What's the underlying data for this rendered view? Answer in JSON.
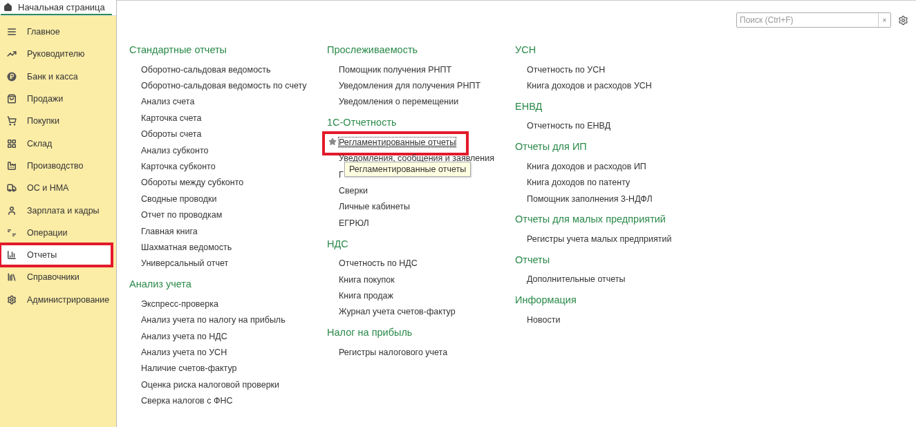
{
  "home_tab": {
    "label": "Начальная страница",
    "selected": true
  },
  "sidebar": {
    "items": [
      {
        "label": "Главное",
        "selected": false,
        "highlighted": false
      },
      {
        "label": "Руководителю",
        "selected": false,
        "highlighted": false
      },
      {
        "label": "Банк и касса",
        "selected": false,
        "highlighted": false
      },
      {
        "label": "Продажи",
        "selected": false,
        "highlighted": false
      },
      {
        "label": "Покупки",
        "selected": false,
        "highlighted": false
      },
      {
        "label": "Склад",
        "selected": false,
        "highlighted": false
      },
      {
        "label": "Производство",
        "selected": false,
        "highlighted": false
      },
      {
        "label": "ОС и НМА",
        "selected": false,
        "highlighted": false
      },
      {
        "label": "Зарплата и кадры",
        "selected": false,
        "highlighted": false
      },
      {
        "label": "Операции",
        "selected": false,
        "highlighted": false
      },
      {
        "label": "Отчеты",
        "selected": true,
        "highlighted": true
      },
      {
        "label": "Справочники",
        "selected": false,
        "highlighted": false
      },
      {
        "label": "Администрирование",
        "selected": false,
        "highlighted": false
      }
    ]
  },
  "search": {
    "placeholder": "Поиск (Ctrl+F)",
    "clear": "×"
  },
  "columns": [
    {
      "sections": [
        {
          "title": "Стандартные отчеты",
          "items": [
            {
              "label": "Оборотно-сальдовая ведомость",
              "highlighted": false
            },
            {
              "label": "Оборотно-сальдовая ведомость по счету",
              "highlighted": false
            },
            {
              "label": "Анализ счета",
              "highlighted": false
            },
            {
              "label": "Карточка счета",
              "highlighted": false
            },
            {
              "label": "Обороты счета",
              "highlighted": false
            },
            {
              "label": "Анализ субконто",
              "highlighted": false
            },
            {
              "label": "Карточка субконто",
              "highlighted": false
            },
            {
              "label": "Обороты между субконто",
              "highlighted": false
            },
            {
              "label": "Сводные проводки",
              "highlighted": false
            },
            {
              "label": "Отчет по проводкам",
              "highlighted": false
            },
            {
              "label": "Главная книга",
              "highlighted": false
            },
            {
              "label": "Шахматная ведомость",
              "highlighted": false
            },
            {
              "label": "Универсальный отчет",
              "highlighted": false
            }
          ]
        },
        {
          "title": "Анализ учета",
          "items": [
            {
              "label": "Экспресс-проверка",
              "highlighted": false
            },
            {
              "label": "Анализ учета по налогу на прибыль",
              "highlighted": false
            },
            {
              "label": "Анализ учета по НДС",
              "highlighted": false
            },
            {
              "label": "Анализ учета по УСН",
              "highlighted": false
            },
            {
              "label": "Наличие счетов-фактур",
              "highlighted": false
            },
            {
              "label": "Оценка риска налоговой проверки",
              "highlighted": false
            },
            {
              "label": "Сверка налогов с ФНС",
              "highlighted": false
            }
          ]
        }
      ]
    },
    {
      "sections": [
        {
          "title": "Прослеживаемость",
          "items": [
            {
              "label": "Помощник получения РНПТ",
              "highlighted": false
            },
            {
              "label": "Уведомления для получения РНПТ",
              "highlighted": false
            },
            {
              "label": "Уведомления о перемещении",
              "highlighted": false
            }
          ]
        },
        {
          "title": "1С-Отчетность",
          "items": [
            {
              "label": "Регламентированные отчеты",
              "highlighted": true,
              "starred": true,
              "tooltip": "Регламентированные отчеты"
            },
            {
              "label": "Уведомления, сообщения и заявления",
              "highlighted": false
            },
            {
              "label": "Г",
              "highlighted": false
            },
            {
              "label": "Сверки",
              "highlighted": false
            },
            {
              "label": "Личные кабинеты",
              "highlighted": false
            },
            {
              "label": "ЕГРЮЛ",
              "highlighted": false
            }
          ]
        },
        {
          "title": "НДС",
          "items": [
            {
              "label": "Отчетность по НДС",
              "highlighted": false
            },
            {
              "label": "Книга покупок",
              "highlighted": false
            },
            {
              "label": "Книга продаж",
              "highlighted": false
            },
            {
              "label": "Журнал учета счетов-фактур",
              "highlighted": false
            }
          ]
        },
        {
          "title": "Налог на прибыль",
          "items": [
            {
              "label": "Регистры налогового учета",
              "highlighted": false
            }
          ]
        }
      ]
    },
    {
      "sections": [
        {
          "title": "УСН",
          "items": [
            {
              "label": "Отчетность по УСН",
              "highlighted": false
            },
            {
              "label": "Книга доходов и расходов УСН",
              "highlighted": false
            }
          ]
        },
        {
          "title": "ЕНВД",
          "items": [
            {
              "label": "Отчетность по ЕНВД",
              "highlighted": false
            }
          ]
        },
        {
          "title": "Отчеты для ИП",
          "items": [
            {
              "label": "Книга доходов и расходов ИП",
              "highlighted": false
            },
            {
              "label": "Книга доходов по патенту",
              "highlighted": false
            },
            {
              "label": "Помощник заполнения 3-НДФЛ",
              "highlighted": false
            }
          ]
        },
        {
          "title": "Отчеты для малых предприятий",
          "items": [
            {
              "label": "Регистры учета малых предприятий",
              "highlighted": false
            }
          ]
        },
        {
          "title": "Отчеты",
          "items": [
            {
              "label": "Дополнительные отчеты",
              "highlighted": false
            }
          ]
        },
        {
          "title": "Информация",
          "items": [
            {
              "label": "Новости",
              "highlighted": false
            }
          ]
        }
      ]
    }
  ]
}
